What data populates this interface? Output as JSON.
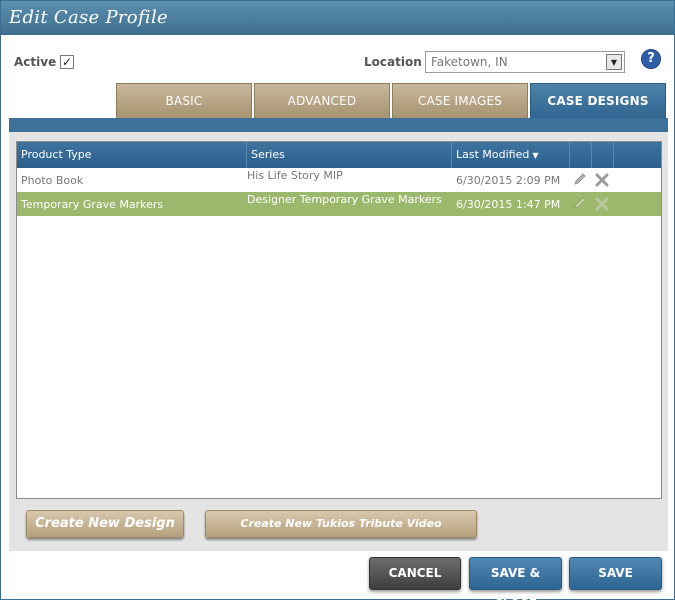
{
  "window": {
    "title": "Edit Case Profile"
  },
  "profile": {
    "active_label": "Active",
    "active_checked": true,
    "location_label": "Location",
    "location_value": "Faketown, IN",
    "help_glyph": "?"
  },
  "tabs": [
    {
      "label": "BASIC",
      "active": false
    },
    {
      "label": "ADVANCED",
      "active": false
    },
    {
      "label": "CASE IMAGES",
      "active": false
    },
    {
      "label": "CASE DESIGNS",
      "active": true
    }
  ],
  "grid": {
    "columns": {
      "product_type": "Product Type",
      "series": "Series",
      "last_modified": "Last Modified"
    },
    "rows": [
      {
        "product_type": "Photo Book",
        "series": "His Life Story MIP",
        "last_modified": "6/30/2015 2:09 PM",
        "selected": false
      },
      {
        "product_type": "Temporary Grave Markers",
        "series": "Designer Temporary Grave Markers",
        "last_modified": "6/30/2015 1:47 PM",
        "selected": true
      }
    ]
  },
  "actions": {
    "create_design": "Create New Design",
    "create_tribute": "Create New Tukios Tribute Video"
  },
  "footer": {
    "cancel": "CANCEL",
    "save_close": "SAVE & CLOSE",
    "save": "SAVE"
  },
  "colors": {
    "titlebar": "#4a7d9f",
    "tab_inactive": "#b8a582",
    "tab_active": "#3d719a",
    "row_selected": "#9cb86c"
  }
}
